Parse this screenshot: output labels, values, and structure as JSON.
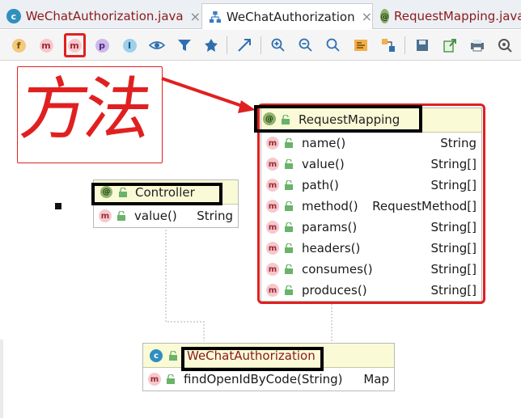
{
  "tabs": [
    {
      "label": "WeChatAuthorization.java",
      "icon": "class-c-icon",
      "active": false,
      "close": "×"
    },
    {
      "label": "WeChatAuthorization",
      "icon": "hierarchy-icon",
      "active": true,
      "close": "×"
    },
    {
      "label": "RequestMapping.java",
      "icon": "annotation-icon",
      "active": false
    }
  ],
  "toolbar": {
    "fields_label": "f",
    "methods_label": "m",
    "constructors_label": "m",
    "properties_label": "p",
    "inner_label": "I"
  },
  "annotation": {
    "handwriting": "方法"
  },
  "cards": {
    "request_mapping": {
      "badge": "@",
      "title": "RequestMapping",
      "rows": [
        {
          "name": "name()",
          "type": "String"
        },
        {
          "name": "value()",
          "type": "String[]"
        },
        {
          "name": "path()",
          "type": "String[]"
        },
        {
          "name": "method()",
          "type": "RequestMethod[]"
        },
        {
          "name": "params()",
          "type": "String[]"
        },
        {
          "name": "headers()",
          "type": "String[]"
        },
        {
          "name": "consumes()",
          "type": "String[]"
        },
        {
          "name": "produces()",
          "type": "String[]"
        }
      ]
    },
    "controller": {
      "badge": "@",
      "title": "Controller",
      "rows": [
        {
          "name": "value()",
          "type": "String"
        }
      ]
    },
    "wechat": {
      "badge": "c",
      "title": "WeChatAuthorization",
      "rows": [
        {
          "name": "findOpenIdByCode(String)",
          "type": "Map"
        }
      ]
    }
  },
  "colors": {
    "highlight_red": "#e02020",
    "card_header": "#fafad7",
    "method_badge": "#f6c8cc"
  }
}
